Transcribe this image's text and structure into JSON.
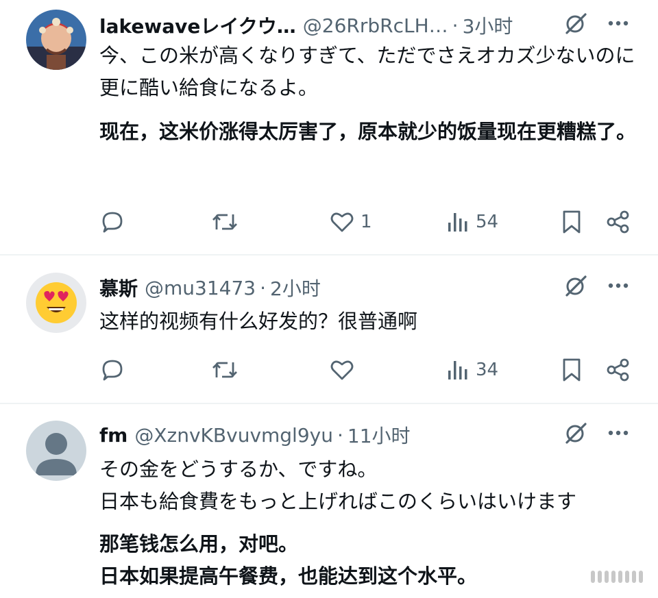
{
  "tweets": [
    {
      "name": "lakewaveレイクウ…",
      "handle": "@26RrbRcLH…",
      "time": "3小时",
      "text_original": "今、この米が高くなりすぎて、ただでさえオカズ少ないのに更に酷い給食になるよ。",
      "text_translation": "现在，这米价涨得太厉害了，原本就少的饭量现在更糟糕了。",
      "likes": "1",
      "views": "54"
    },
    {
      "name": "慕斯",
      "handle": "@mu31473",
      "time": "2小时",
      "text_original": "这样的视频有什么好发的？很普通啊",
      "likes": "",
      "views": "34"
    },
    {
      "name": "fm",
      "handle": "@XznvKBvuvmgl9yu",
      "time": "11小时",
      "text_original": "その金をどうするか、ですね。\n日本も給食費をもっと上げればこのくらいはいけます",
      "text_translation": "那笔钱怎么用，对吧。\n日本如果提高午餐费，也能达到这个水平。"
    }
  ],
  "separator": "·",
  "icons": [
    "grok-icon",
    "more-icon",
    "reply-icon",
    "retweet-icon",
    "like-icon",
    "views-icon",
    "bookmark-icon",
    "share-icon"
  ],
  "colors": {
    "text": "#0f1419",
    "muted": "#536471",
    "divider": "#eff3f4"
  }
}
